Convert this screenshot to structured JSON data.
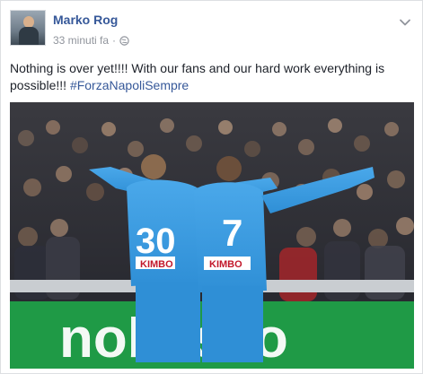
{
  "post": {
    "author_name": "Marko Rog",
    "timestamp": "33 minuti fa",
    "privacy_separator": "·",
    "text_main": "Nothing is over yet!!!! With our fans and our hard work everything is possible!!! ",
    "hashtag": "#ForzaNapoliSempre",
    "privacy_icon": "globe-icon",
    "menu_icon": "chevron-down-icon"
  },
  "photo": {
    "player_left_number": "30",
    "player_right_number": "7",
    "sponsor_left": "KIMBO",
    "sponsor_right": "KIMBO",
    "board_text": "nobasco",
    "jersey_color": "#2f8fd6",
    "board_color": "#1f9a46"
  },
  "colors": {
    "link": "#365899",
    "muted": "#90949c",
    "text": "#1d2129"
  }
}
